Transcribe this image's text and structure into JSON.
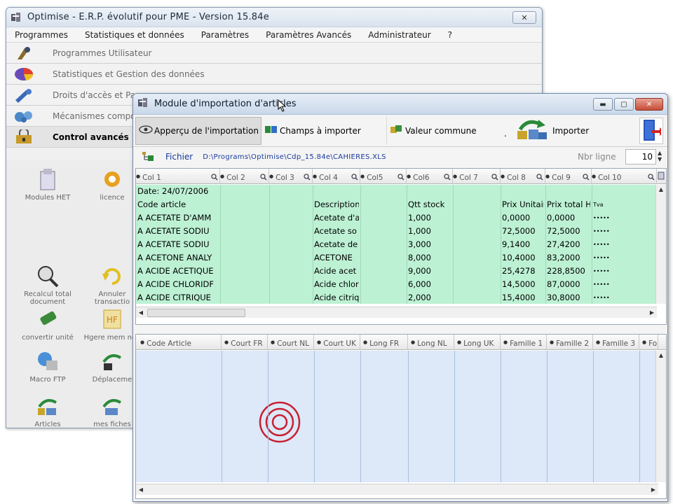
{
  "main_window": {
    "title": "Optimise  -  E.R.P. évolutif pour PME   -  Version 15.84e",
    "close_label": "✕",
    "menu": [
      "Programmes",
      "Statistiques et données",
      "Paramètres",
      "Paramètres Avancés",
      "Administrateur",
      "?"
    ],
    "nav": [
      {
        "label": "Programmes Utilisateur",
        "icon": "user-programs-icon"
      },
      {
        "label": "Statistiques et Gestion des données",
        "icon": "statistics-icon"
      },
      {
        "label": "Droits d'accès et Pa",
        "icon": "access-rights-icon"
      },
      {
        "label": "Mécanismes compo",
        "icon": "mechanisms-icon"
      },
      {
        "label": "Control avancés",
        "icon": "advanced-control-icon"
      }
    ],
    "tiles": [
      {
        "label": "Modules HET",
        "icon": "modules-het-icon"
      },
      {
        "label": "licence",
        "icon": "licence-gear-icon"
      },
      {
        "label": "Recalcul total document",
        "icon": "recalculate-icon"
      },
      {
        "label": "Annuler transactio",
        "icon": "cancel-transaction-icon"
      },
      {
        "label": "convertir unité",
        "icon": "convert-unit-icon"
      },
      {
        "label": "Hgere mem non",
        "icon": "memory-icon"
      },
      {
        "label": "Macro FTP",
        "icon": "macro-ftp-icon"
      },
      {
        "label": "Déplaceme",
        "icon": "move-icon"
      },
      {
        "label": "Articles",
        "icon": "articles-icon"
      },
      {
        "label": "mes fiches",
        "icon": "my-records-icon"
      }
    ]
  },
  "module_window": {
    "title": "Module d'importation d'articles",
    "buttons": {
      "minimize": "▬",
      "maximize": "▢",
      "close": "✕"
    },
    "toolbar": {
      "preview": "Apperçu de l'importation",
      "fields": "Champs à importer",
      "common_value": "Valeur commune",
      "dot": ".",
      "import": "Importer"
    },
    "file": {
      "label": "Fichier",
      "path": "D:\\Programs\\Optimise\\Cdp_15.84e\\CAHIERES.XLS",
      "nbr_label": "Nbr ligne",
      "nbr_value": "10"
    },
    "import_grid": {
      "headers": [
        "Col 1",
        "Col 2",
        "Col 3",
        "Col 4",
        "Col5",
        "Col6",
        "Col 7",
        "Col 8",
        "Col 9",
        "Col 10"
      ],
      "rows": [
        [
          "Date: 24/07/2006",
          "",
          "",
          "",
          "",
          "",
          "",
          "",
          "",
          ""
        ],
        [
          "Code article",
          "",
          "",
          "Description",
          "",
          "Qtt stock",
          "",
          "Prix Unitair",
          "Prix total H",
          "Tva"
        ],
        [
          "A ACETATE D'AMM",
          "",
          "",
          "Acetate d'a",
          "",
          "1,000",
          "",
          "0,0000",
          "0,0000",
          "•••••"
        ],
        [
          "A ACETATE SODIU",
          "",
          "",
          "Acetate so",
          "",
          "1,000",
          "",
          "72,5000",
          "72,5000",
          "•••••"
        ],
        [
          "A ACETATE SODIU",
          "",
          "",
          "Acetate de",
          "",
          "3,000",
          "",
          "9,1400",
          "27,4200",
          "•••••"
        ],
        [
          "A ACETONE ANALY",
          "",
          "",
          "ACETONE",
          "",
          "8,000",
          "",
          "10,4000",
          "83,2000",
          "•••••"
        ],
        [
          "A ACIDE ACETIQUE",
          "",
          "",
          "Acide acet",
          "",
          "9,000",
          "",
          "25,4278",
          "228,8500",
          "•••••"
        ],
        [
          "A ACIDE CHLORIDF",
          "",
          "",
          "Acide chlor",
          "",
          "6,000",
          "",
          "14,5000",
          "87,0000",
          "•••••"
        ],
        [
          "A ACIDE CITRIQUE",
          "",
          "",
          "Acide citriq",
          "",
          "2,000",
          "",
          "15,4000",
          "30,8000",
          "•••••"
        ]
      ]
    },
    "mapping_grid": {
      "headers": [
        "Code Article",
        "Court FR",
        "Court NL",
        "Court UK",
        "Long FR",
        "Long NL",
        "Long UK",
        "Famille 1",
        "Famille 2",
        "Famille 3",
        "Fo"
      ]
    }
  }
}
